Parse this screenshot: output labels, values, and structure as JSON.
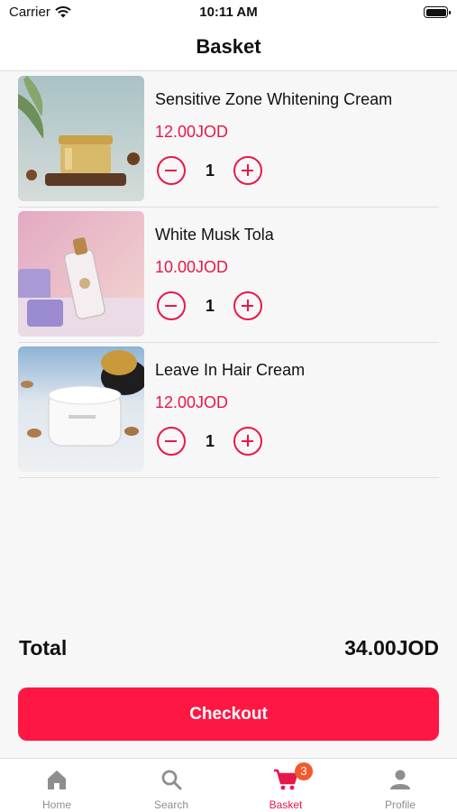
{
  "status_bar": {
    "carrier": "Carrier",
    "time": "10:11 AM"
  },
  "header": {
    "title": "Basket"
  },
  "basket": {
    "items": [
      {
        "name": "Sensitive Zone Whitening Cream",
        "price": "12.00JOD",
        "quantity": "1"
      },
      {
        "name": "White Musk Tola",
        "price": "10.00JOD",
        "quantity": "1"
      },
      {
        "name": "Leave In Hair Cream",
        "price": "12.00JOD",
        "quantity": "1"
      }
    ]
  },
  "summary": {
    "total_label": "Total",
    "total_value": "34.00JOD"
  },
  "checkout": {
    "label": "Checkout"
  },
  "tab_bar": {
    "tabs": [
      {
        "label": "Home",
        "icon": "home-icon"
      },
      {
        "label": "Search",
        "icon": "search-icon"
      },
      {
        "label": "Basket",
        "icon": "cart-icon",
        "badge": "3",
        "active": true
      },
      {
        "label": "Profile",
        "icon": "person-icon"
      }
    ]
  },
  "colors": {
    "accent": "#e8174a",
    "checkout_button": "#ff1744",
    "badge": "#f25a2b",
    "background": "#f7f7f7"
  }
}
